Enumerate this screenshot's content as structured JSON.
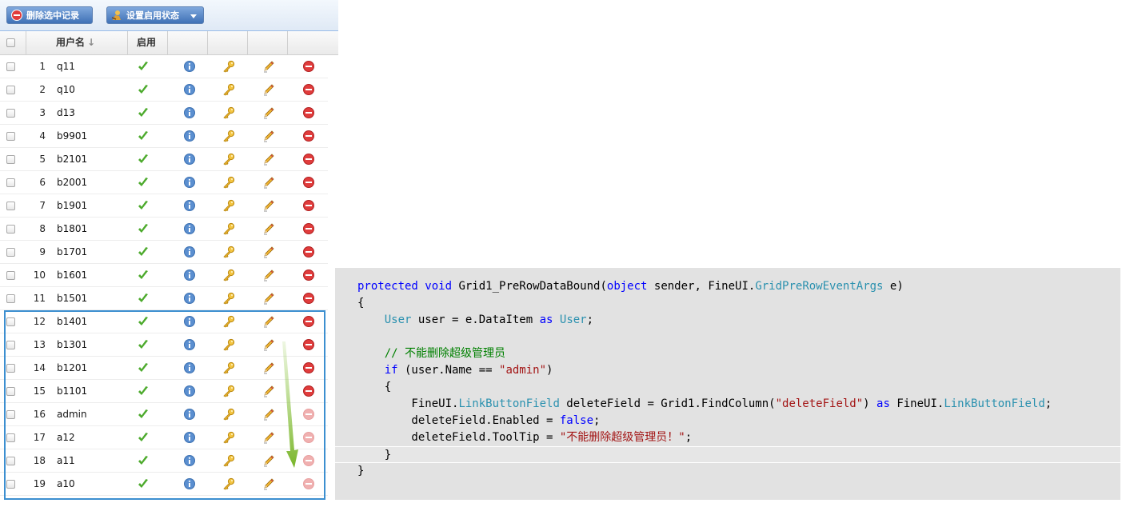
{
  "toolbar": {
    "delete_label": "删除选中记录",
    "status_label": "设置启用状态"
  },
  "header": {
    "username": "用户名",
    "sort_icon": "↓",
    "enabled": "启用"
  },
  "icons": {
    "check": "check-icon",
    "info": "info-icon",
    "key": "key-icon",
    "edit": "pencil-icon",
    "delete": "delete-icon"
  },
  "colors": {
    "check": "#4caa2c",
    "info": "#5b8fd0",
    "delete_enabled": "#e03c3c",
    "delete_disabled": "#f0b0b0",
    "highlight_border": "#3c8fd0",
    "arrow": "#8cc63f"
  },
  "rows": [
    {
      "num": "1",
      "name": "q11",
      "deletable": true
    },
    {
      "num": "2",
      "name": "q10",
      "deletable": true
    },
    {
      "num": "3",
      "name": "d13",
      "deletable": true
    },
    {
      "num": "4",
      "name": "b9901",
      "deletable": true
    },
    {
      "num": "5",
      "name": "b2101",
      "deletable": true
    },
    {
      "num": "6",
      "name": "b2001",
      "deletable": true
    },
    {
      "num": "7",
      "name": "b1901",
      "deletable": true
    },
    {
      "num": "8",
      "name": "b1801",
      "deletable": true
    },
    {
      "num": "9",
      "name": "b1701",
      "deletable": true
    },
    {
      "num": "10",
      "name": "b1601",
      "deletable": true
    },
    {
      "num": "11",
      "name": "b1501",
      "deletable": true
    },
    {
      "num": "12",
      "name": "b1401",
      "deletable": true
    },
    {
      "num": "13",
      "name": "b1301",
      "deletable": true
    },
    {
      "num": "14",
      "name": "b1201",
      "deletable": true
    },
    {
      "num": "15",
      "name": "b1101",
      "deletable": true
    },
    {
      "num": "16",
      "name": "admin",
      "deletable": false
    },
    {
      "num": "17",
      "name": "a12",
      "deletable": false
    },
    {
      "num": "18",
      "name": "a11",
      "deletable": false
    },
    {
      "num": "19",
      "name": "a10",
      "deletable": false
    }
  ],
  "code_lines": [
    [
      [
        "kw",
        "protected"
      ],
      [
        "pl",
        " "
      ],
      [
        "kw",
        "void"
      ],
      [
        "pl",
        " Grid1_PreRowDataBound("
      ],
      [
        "kw",
        "object"
      ],
      [
        "pl",
        " sender, FineUI."
      ],
      [
        "ty",
        "GridPreRowEventArgs"
      ],
      [
        "pl",
        " e)"
      ]
    ],
    [
      [
        "pl",
        "{"
      ]
    ],
    [
      [
        "pl",
        "    "
      ],
      [
        "ty",
        "User"
      ],
      [
        "pl",
        " user = e.DataItem "
      ],
      [
        "kw",
        "as"
      ],
      [
        "pl",
        " "
      ],
      [
        "ty",
        "User"
      ],
      [
        "pl",
        ";"
      ]
    ],
    [
      [
        "pl",
        ""
      ]
    ],
    [
      [
        "pl",
        "    "
      ],
      [
        "cm",
        "// 不能删除超级管理员"
      ]
    ],
    [
      [
        "pl",
        "    "
      ],
      [
        "kw",
        "if"
      ],
      [
        "pl",
        " (user.Name == "
      ],
      [
        "st",
        "\"admin\""
      ],
      [
        "pl",
        ")"
      ]
    ],
    [
      [
        "pl",
        "    {"
      ]
    ],
    [
      [
        "pl",
        "        FineUI."
      ],
      [
        "ty",
        "LinkButtonField"
      ],
      [
        "pl",
        " deleteField = Grid1.FindColumn("
      ],
      [
        "st",
        "\"deleteField\""
      ],
      [
        "pl",
        ") "
      ],
      [
        "kw",
        "as"
      ],
      [
        "pl",
        " FineUI."
      ],
      [
        "ty",
        "LinkButtonField"
      ],
      [
        "pl",
        ";"
      ]
    ],
    [
      [
        "pl",
        "        deleteField.Enabled = "
      ],
      [
        "kw",
        "false"
      ],
      [
        "pl",
        ";"
      ]
    ],
    [
      [
        "pl",
        "        deleteField.ToolTip = "
      ],
      [
        "st",
        "\"不能删除超级管理员！\""
      ],
      [
        "pl",
        ";"
      ]
    ],
    [
      [
        "pl",
        "    }"
      ]
    ],
    [
      [
        "pl",
        "}"
      ]
    ]
  ]
}
